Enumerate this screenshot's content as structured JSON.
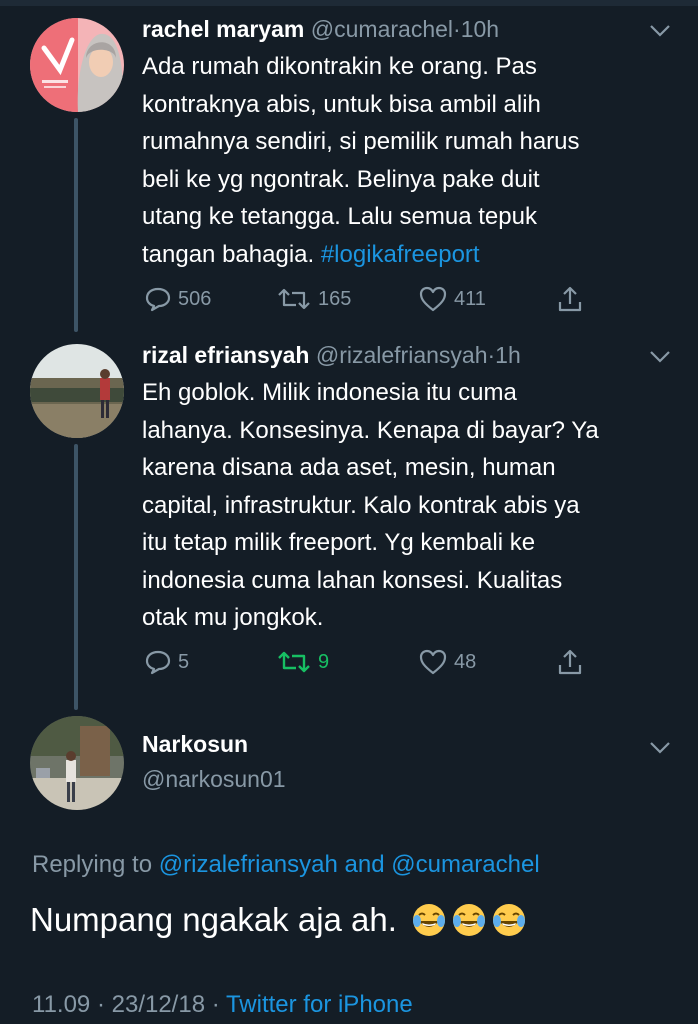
{
  "tweets": [
    {
      "display_name": "rachel maryam",
      "handle": "@cumarachel",
      "separator": "·",
      "time": "10h",
      "lines": [
        "Ada rumah dikontrakin ke orang. Pas",
        "kontraknya abis, untuk bisa ambil alih",
        "rumahnya sendiri, si pemilik rumah harus",
        "beli ke yg ngontrak. Belinya pake duit",
        "utang ke tetangga. Lalu semua tepuk"
      ],
      "last_line_prefix": "tangan bahagia. ",
      "hashtag": "#logikafreeport",
      "replies": "506",
      "retweets": "165",
      "likes": "411"
    },
    {
      "display_name": "rizal efriansyah",
      "handle": "@rizalefriansyah",
      "separator": "·",
      "time": "1h",
      "lines": [
        "Eh goblok. Milik indonesia itu cuma",
        "lahanya. Konsesinya. Kenapa di bayar? Ya",
        "karena disana ada aset, mesin, human",
        "capital, infrastruktur. Kalo kontrak abis ya",
        "itu tetap milik freeport. Yg kembali ke",
        "indonesia cuma lahan konsesi. Kualitas",
        "otak mu jongkok."
      ],
      "replies": "5",
      "retweets": "9",
      "likes": "48"
    }
  ],
  "main_tweet": {
    "display_name": "Narkosun",
    "handle": "@narkosun01",
    "replying_prefix": "Replying to",
    "replying_user1": "@rizalefriansyah",
    "replying_and": "and",
    "replying_user2": "@cumarachel",
    "text": "Numpang ngakak aja ah.",
    "emoji": [
      "face-with-tears-of-joy",
      "face-with-tears-of-joy",
      "face-with-tears-of-joy"
    ],
    "time": "11.09",
    "separator": "·",
    "date": "23/12/18",
    "source": "Twitter for iPhone"
  },
  "colors": {
    "background": "#141d26",
    "secondary_text": "#8899a6",
    "link": "#1b95e0",
    "retweet_active": "#17bf63"
  }
}
